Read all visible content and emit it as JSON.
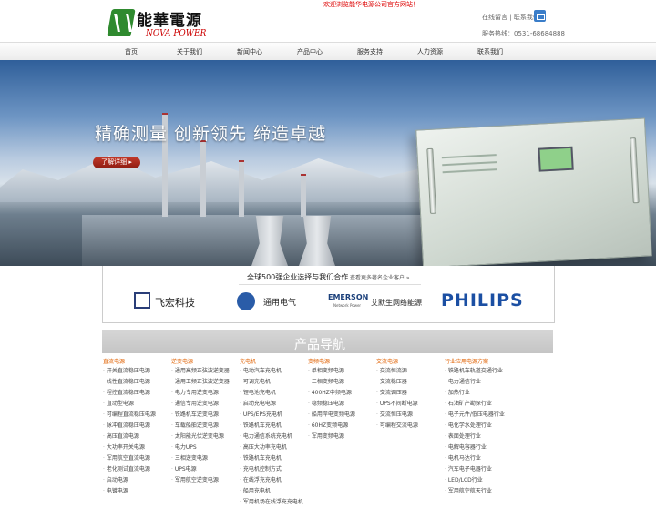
{
  "top_notice": "欢迎浏览能华电源公司官方网站！",
  "logo": {
    "cn": "能華電源",
    "en": "NOVA POWER",
    "brand_color": "#2f8a2f"
  },
  "top_links": {
    "guestbook": "在线留言",
    "sep": "|",
    "contact": "联系我们"
  },
  "hotline": {
    "label": "服务热线：",
    "number": "0531-68684888"
  },
  "nav": [
    "首页",
    "关于我们",
    "新闻中心",
    "产品中心",
    "服务支持",
    "人力资源",
    "联系我们"
  ],
  "banner": {
    "slogan": "精确测量  创新领先  缔造卓越",
    "button": "了解详细 ▸"
  },
  "partners": {
    "title": "全球500强企业选择与我们合作",
    "subtitle": "查看更多著名企业客户 »",
    "logos": [
      {
        "name": "飞宏科技",
        "icon": "phihong-icon"
      },
      {
        "name": "通用电气",
        "icon": "ge-icon"
      },
      {
        "name": "艾默生网络能源",
        "mark": "EMERSON",
        "tagline": "Network Power",
        "icon": "emerson-icon"
      },
      {
        "name": "PHILIPS",
        "icon": "philips-wordmark"
      }
    ]
  },
  "product_nav": {
    "title": "产品导航",
    "columns": [
      {
        "heading": "直流电源",
        "items": [
          "开关直流稳压电源",
          "线性直流稳压电源",
          "程控直流稳压电源",
          "直动型电源",
          "可编程直流稳压电源",
          "脉冲直流稳压电源",
          "高压直流电源",
          "大功率开关电源",
          "军用航空直流电源",
          "老化测试直流电源",
          "启动电源",
          "电镀电源"
        ]
      },
      {
        "heading": "逆变电源",
        "items": [
          "通用高频正弦波逆变器",
          "通用工频正弦波逆变器",
          "电力专用逆变电源",
          "通信专用逆变电源",
          "铁路机车逆变电源",
          "车载船舶逆变电源",
          "太阳能光伏逆变电源",
          "电力UPS",
          "三相逆变电源",
          "UPS电源",
          "军用航空逆变电源"
        ]
      },
      {
        "heading": "充电机",
        "items": [
          "电动汽车充电机",
          "可调充电机",
          "锂电池充电机",
          "启动充电电源",
          "UPS/EPS充电机",
          "铁路机车充电机",
          "电力通信系统充电机",
          "高压大功率充电机",
          "铁路机车充电机",
          "充电机控制方式",
          "在线浮充充电机",
          "船用充电机",
          "军用机场在线浮充充电机"
        ]
      },
      {
        "heading": "变频电源",
        "items": [
          "单相变频电源",
          "三相变频电源",
          "400HZ中频电源",
          "稳频稳压电源",
          "船用岸电变频电源",
          "60HZ变频电源",
          "军用变频电源"
        ]
      },
      {
        "heading": "交流电源",
        "items": [
          "交流恒流源",
          "交流稳压器",
          "交流调压器",
          "UPS不间断电源",
          "交流恒压电源",
          "可编程交流电源"
        ]
      },
      {
        "heading": "行业应用电源方案",
        "items": [
          "铁路机车轨道交通行业",
          "电力通信行业",
          "加热行业",
          "石油矿产勘探行业",
          "电子元件/低压电器行业",
          "电化学水处理行业",
          "表面处理行业",
          "电解电容器行业",
          "电机马达行业",
          "汽车电子电器行业",
          "LED/LCD行业",
          "军用航空航天行业"
        ]
      }
    ]
  }
}
